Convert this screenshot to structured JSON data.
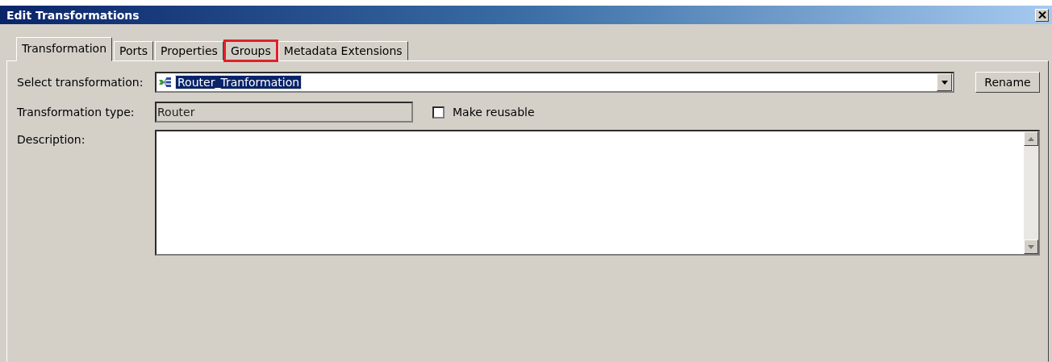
{
  "window": {
    "title": "Edit Transformations"
  },
  "tabs": [
    {
      "label": "Transformation",
      "selected": true,
      "highlighted": false
    },
    {
      "label": "Ports",
      "selected": false,
      "highlighted": false
    },
    {
      "label": "Properties",
      "selected": false,
      "highlighted": false
    },
    {
      "label": "Groups",
      "selected": false,
      "highlighted": true
    },
    {
      "label": "Metadata Extensions",
      "selected": false,
      "highlighted": false
    }
  ],
  "select_transformation": {
    "label": "Select transformation:",
    "value": "Router_Tranformation"
  },
  "rename_button": "Rename",
  "transformation_type": {
    "label": "Transformation type:",
    "value": "Router"
  },
  "make_reusable": {
    "label": "Make reusable",
    "checked": false
  },
  "description": {
    "label": "Description:"
  }
}
